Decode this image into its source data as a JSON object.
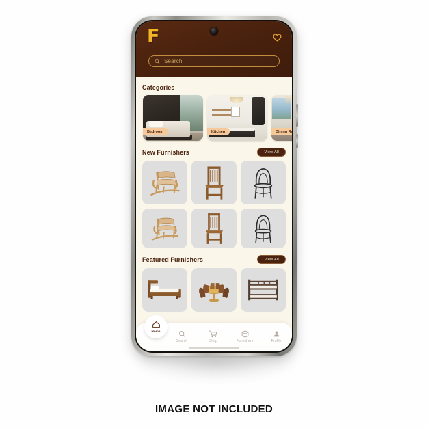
{
  "caption": "IMAGE NOT INCLUDED",
  "app": {
    "logo_text": "F",
    "favorite_icon": "heart-icon",
    "camera_icon": "front-camera",
    "search": {
      "icon": "search-icon",
      "placeholder": "Search",
      "value": ""
    }
  },
  "sections": {
    "categories": {
      "title": "Categories",
      "items": [
        {
          "label": "Bedroom",
          "scene": "bedroom"
        },
        {
          "label": "Kitchen",
          "scene": "kitchen"
        },
        {
          "label": "Dining Roo",
          "scene": "dining"
        }
      ]
    },
    "new_furnishers": {
      "title": "New Furnishers",
      "view_all_label": "View All",
      "rows": [
        [
          "rocking-chair",
          "wooden-dining-chair",
          "bentwood-chair"
        ],
        [
          "rocking-chair",
          "wooden-dining-chair",
          "bentwood-chair"
        ]
      ]
    },
    "featured_furnishers": {
      "title": "Featured Furnishers",
      "view_all_label": "View All",
      "rows": [
        [
          "wooden-bed",
          "dining-table-set",
          "bunk-bed"
        ]
      ]
    }
  },
  "bottom_nav": {
    "items": [
      {
        "label": "Home",
        "icon": "home-icon",
        "active": true
      },
      {
        "label": "Search",
        "icon": "search-icon",
        "active": false
      },
      {
        "label": "Shop",
        "icon": "cart-icon",
        "active": false
      },
      {
        "label": "Furnishers",
        "icon": "box-icon",
        "active": false
      },
      {
        "label": "Profile",
        "icon": "person-icon",
        "active": false
      }
    ]
  },
  "colors": {
    "header_brown": "#4A2310",
    "accent_gold": "#F2B327",
    "cream_bg": "#FBF6EA",
    "tile_gray": "#DEDEDE",
    "label_peach": "#F6C99A"
  }
}
